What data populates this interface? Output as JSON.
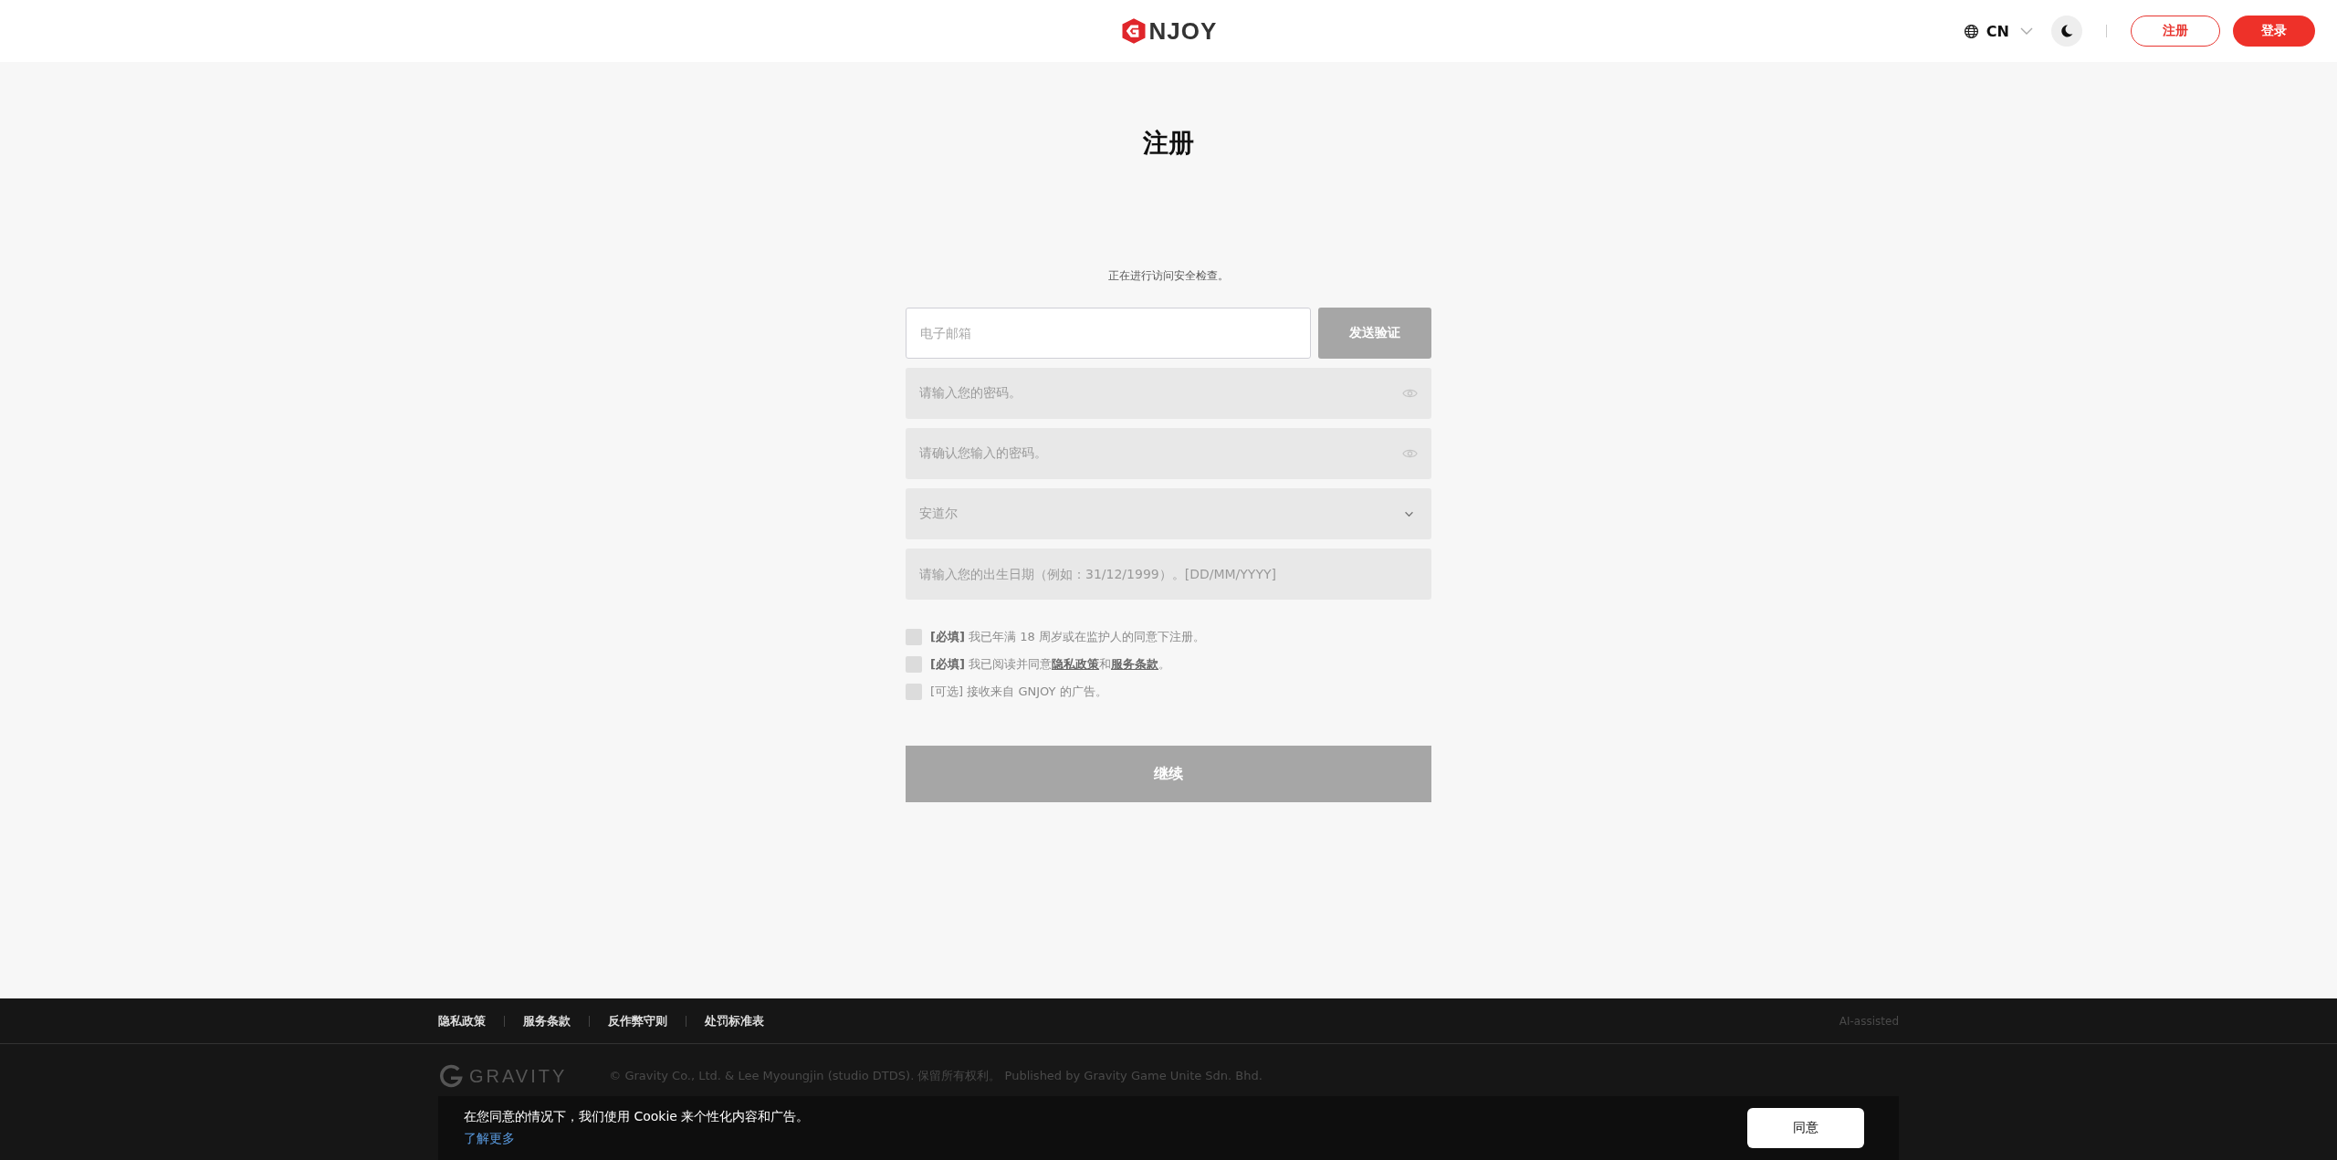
{
  "header": {
    "logo_text": "NJOY",
    "language": "CN",
    "signup_button": "注册",
    "login_button": "登录"
  },
  "title": "注册",
  "notice": "正在进行访问安全检查。",
  "fields": [
    {
      "kind": "email",
      "placeholder": "电子邮箱",
      "disabled": false,
      "button": {
        "label": "发送验证",
        "disabled": true
      }
    },
    {
      "kind": "password",
      "placeholder": "请输入您的密码。",
      "disabled": true
    },
    {
      "kind": "password",
      "placeholder": "请确认您输入的密码。",
      "disabled": true
    },
    {
      "kind": "select",
      "value": "安道尔",
      "disabled": true
    },
    {
      "kind": "date",
      "placeholder": "请输入您的出生日期（例如：31/12/1999）。[DD/MM/YYYY]",
      "disabled": true
    }
  ],
  "agreements": [
    {
      "checked": false,
      "parts": [
        {
          "kind": "text",
          "text": "**[必填]** 我已年满 18 周岁或在监护人的同意下注册。"
        }
      ]
    },
    {
      "checked": false,
      "parts": [
        {
          "kind": "text",
          "text": "**[必填]** 我已阅读并同意"
        },
        {
          "kind": "link",
          "text": "隐私政策"
        },
        {
          "kind": "text",
          "text": "和"
        },
        {
          "kind": "link",
          "text": "服务条款"
        },
        {
          "kind": "text",
          "text": "。"
        }
      ]
    },
    {
      "checked": false,
      "parts": [
        {
          "kind": "text",
          "text": "[可选] 接收来自 GNJOY 的广告。"
        }
      ]
    }
  ],
  "continue_button": {
    "label": "继续",
    "disabled": true
  },
  "footer": {
    "links": [
      "隐私政策",
      "服务条款",
      "反作弊守则",
      "处罚标准表"
    ],
    "badge": "AI-assisted",
    "logo_text": "GRAVITY",
    "copyright": "© Gravity Co., Ltd. & Lee Myoungjin (studio DTDS). 保留所有权利。 Published by Gravity Game Unite Sdn. Bhd."
  },
  "cookie_banner": {
    "message": "在您同意的情况下，我们使用 Cookie 来个性化内容和广告。",
    "link": "了解更多",
    "button": "同意"
  }
}
